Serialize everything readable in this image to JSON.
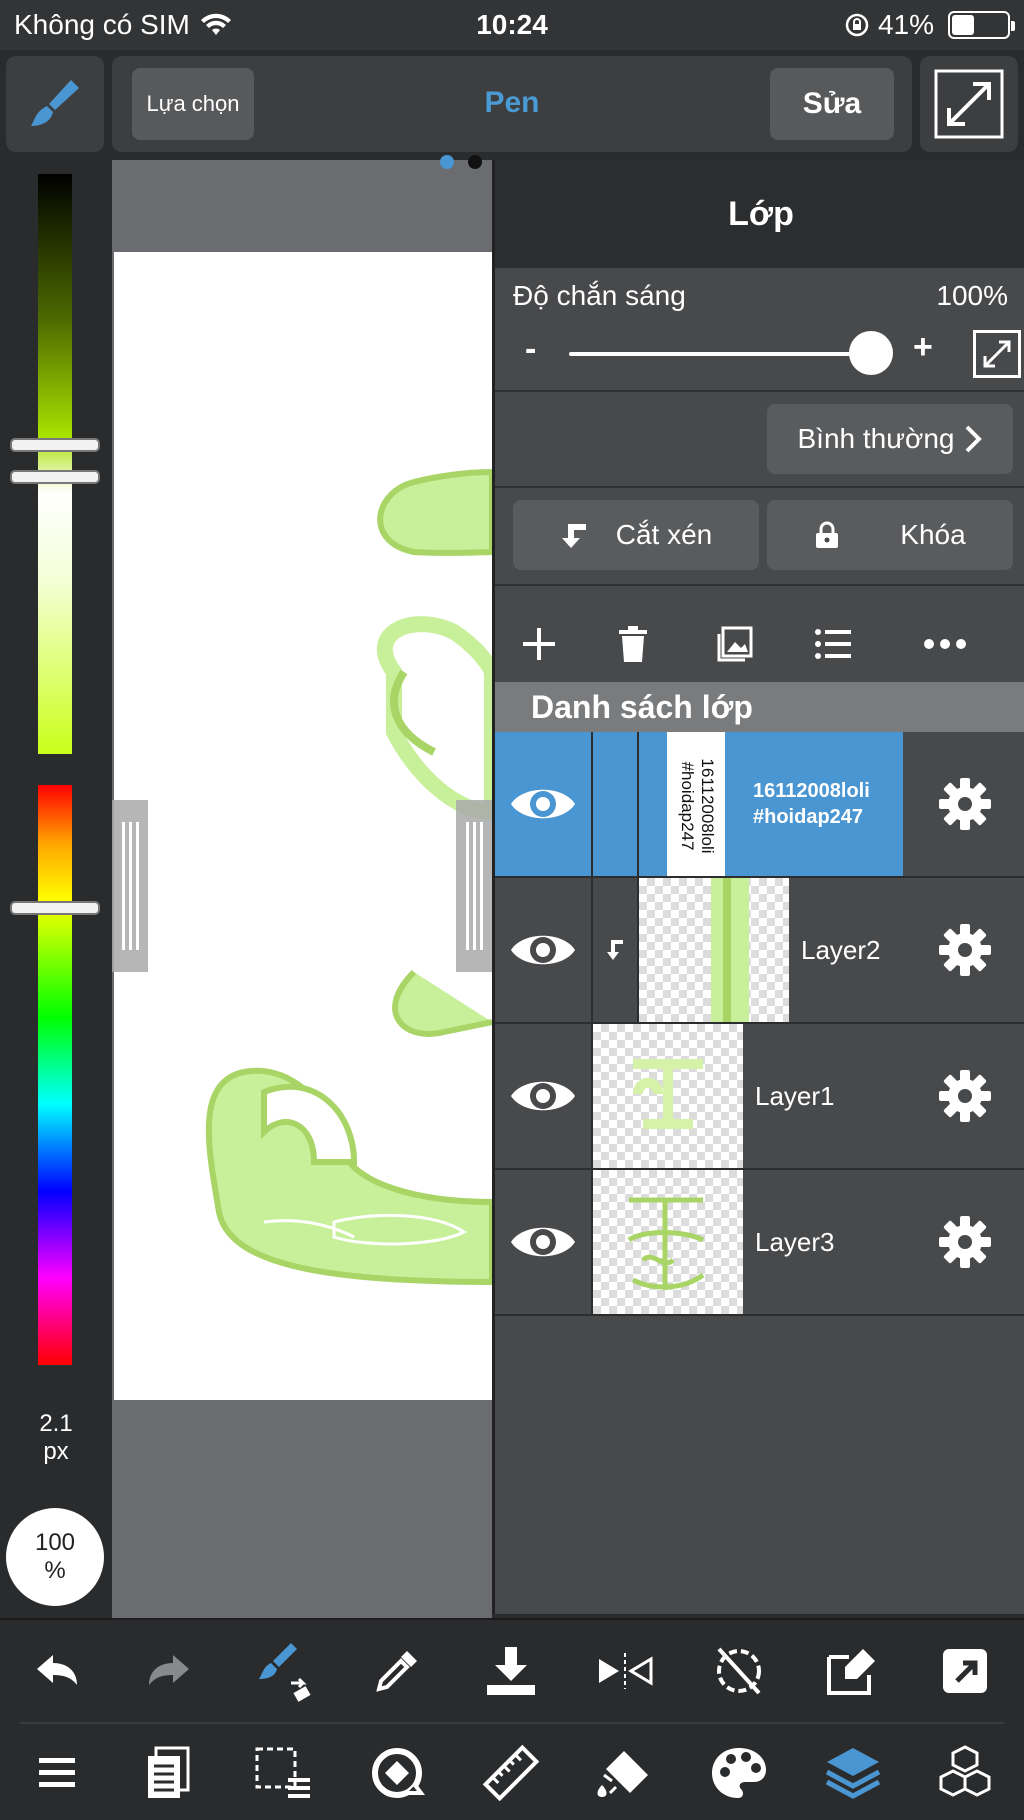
{
  "status_bar": {
    "carrier": "Không có SIM",
    "time": "10:24",
    "battery": "41%",
    "battery_level": 0.41
  },
  "toolbar": {
    "select_label": "Lựa chọn",
    "tool_name": "Pen",
    "edit_label": "Sửa"
  },
  "left_panel": {
    "brush_size_value": "2.1",
    "brush_size_unit": "px",
    "opacity_value": "100",
    "opacity_unit": "%"
  },
  "layer_panel": {
    "title": "Lớp",
    "opacity_label": "Độ chắn sáng",
    "opacity_value": "100%",
    "opacity_level": 1.0,
    "slider_minus": "-",
    "slider_plus": "+",
    "blend_mode": "Bình thường",
    "clip_label": "Cắt xén",
    "lock_label": "Khóa",
    "list_header": "Danh sách lớp",
    "layers": [
      {
        "name_line1": "16112008loli",
        "name_line2": "#hoidap247",
        "thumb_text": "16112008loli #hoidap247",
        "selected": true
      },
      {
        "name": "Layer2",
        "clipped": true
      },
      {
        "name": "Layer1"
      },
      {
        "name": "Layer3"
      }
    ]
  },
  "colors": {
    "accent": "#4a96d2",
    "panel_bg": "#48494b",
    "dark_bg": "#2a2b2d",
    "lime": "#c8f09a"
  },
  "icons": {
    "top": [
      "brush-icon",
      "expand-icon"
    ],
    "layer_actions": [
      "add-layer-icon",
      "delete-layer-icon",
      "image-layer-icon",
      "list-icon",
      "more-icon"
    ],
    "bottom_row1": [
      "undo-icon",
      "redo-icon",
      "brush-swap-icon",
      "eyedropper-icon",
      "download-icon",
      "flip-icon",
      "rotate-off-icon",
      "edit-icon",
      "share-icon"
    ],
    "bottom_row2": [
      "menu-icon",
      "pages-icon",
      "selection-icon",
      "snap-icon",
      "ruler-icon",
      "fill-icon",
      "palette-icon",
      "layers-icon",
      "materials-icon"
    ]
  }
}
